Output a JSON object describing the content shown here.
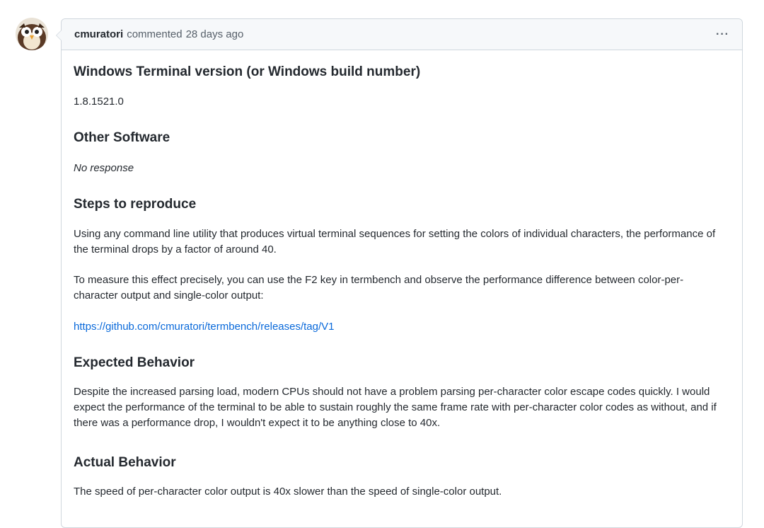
{
  "comment": {
    "author": "cmuratori",
    "action": "commented",
    "time": "28 days ago",
    "more_icon": "kebab-horizontal-icon"
  },
  "sections": [
    {
      "heading": "Windows Terminal version (or Windows build number)",
      "paragraphs": [
        "1.8.1521.0"
      ]
    },
    {
      "heading": "Other Software",
      "paragraphs": [
        "No response"
      ]
    },
    {
      "heading": "Steps to reproduce",
      "paragraphs": [
        "Using any command line utility that produces virtual terminal sequences for setting the colors of individual characters, the performance of the terminal drops by a factor of around 40.",
        "To measure this effect precisely, you can use the F2 key in termbench and observe the performance difference between color-per-character output and single-color output:",
        "https://github.com/cmuratori/termbench/releases/tag/V1"
      ]
    },
    {
      "heading": "Expected Behavior",
      "paragraphs": [
        "Despite the increased parsing load, modern CPUs should not have a problem parsing per-character color escape codes quickly. I would expect the performance of the terminal to be able to sustain roughly the same frame rate with per-character color codes as without, and if there was a performance drop, I wouldn't expect it to be anything close to 40x."
      ]
    },
    {
      "heading": "Actual Behavior",
      "paragraphs": [
        "The speed of per-character color output is 40x slower than the speed of single-color output."
      ]
    }
  ],
  "colors": {
    "link": "#0969da",
    "border": "#d0d7de",
    "header_bg": "#f6f8fa"
  }
}
